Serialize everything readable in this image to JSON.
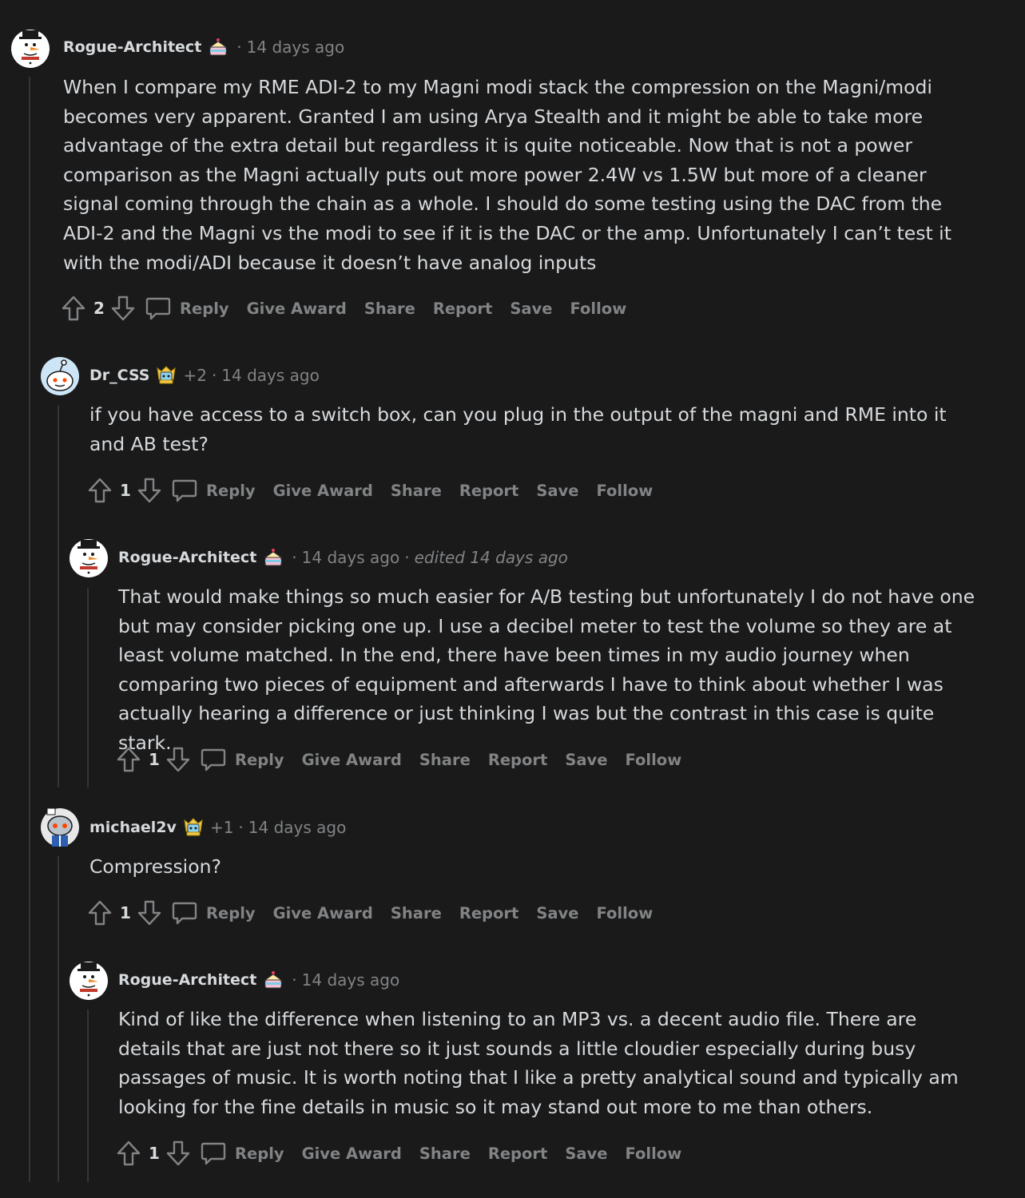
{
  "actions": {
    "reply": "Reply",
    "give_award": "Give Award",
    "share": "Share",
    "report": "Report",
    "save": "Save",
    "follow": "Follow"
  },
  "comments": [
    {
      "author": "Rogue-Architect",
      "time": "14 days ago",
      "body": "When I compare my RME ADI-2 to my Magni modi stack the compression on the Magni/modi becomes very apparent. Granted I am using Arya Stealth and it might be able to take more advantage of the extra detail but regardless it is quite noticeable. Now that is not a power comparison as the Magni actually puts out more power 2.4W vs 1.5W but more of a cleaner signal coming through the chain as a whole. I should do some testing using the DAC from the ADI-2 and the Magni vs the modi to see if it is the DAC or the amp. Unfortunately I can’t test it with the modi/ADI because it doesn’t have analog inputs",
      "votes": "2"
    },
    {
      "author": "Dr_CSS",
      "flair_score": "+2",
      "time": "14 days ago",
      "body": "if you have access to a switch box, can you plug in the output of the magni and RME into it and AB test?",
      "votes": "1"
    },
    {
      "author": "Rogue-Architect",
      "time": "14 days ago",
      "edited": "edited 14 days ago",
      "body": "That would make things so much easier for A/B testing but unfortunately I do not have one but may consider picking one up. I use a decibel meter to test the volume so they are at least volume matched. In the end, there have been times in my audio journey when comparing two pieces of equipment and afterwards I have to think about whether I was actually hearing a difference or just thinking I was but the contrast in this case is quite stark.",
      "votes": "1"
    },
    {
      "author": "michael2v",
      "flair_score": "+1",
      "time": "14 days ago",
      "body": "Compression?",
      "votes": "1"
    },
    {
      "author": "Rogue-Architect",
      "time": "14 days ago",
      "body": "Kind of like the difference when listening to an MP3 vs. a decent audio file. There are details that are just not there so it just sounds a little cloudier especially during busy passages of music. It is worth noting that I like a pretty analytical sound and typically am looking for the fine details in music so it may stand out more to me than others.",
      "votes": "1"
    }
  ],
  "colors": {
    "background": "#1a1a1b",
    "text": "#d7dadc",
    "muted": "#818384",
    "thread_line": "#343536"
  }
}
